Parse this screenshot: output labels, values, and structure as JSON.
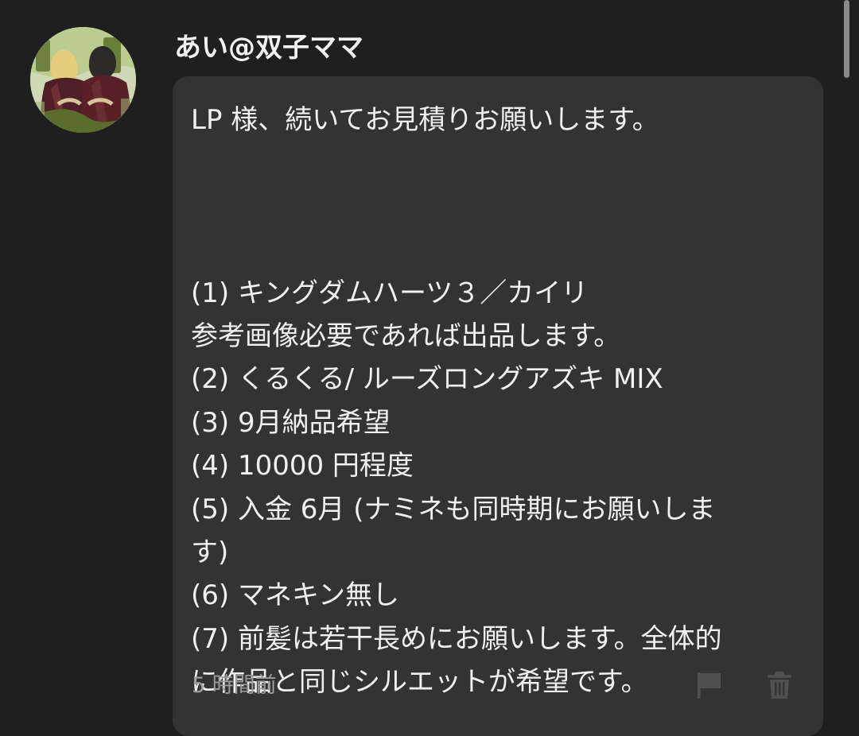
{
  "post": {
    "author_name": "あい@双子ママ",
    "avatar": {
      "icon": "avatar-image",
      "colors": [
        "#cfd9b6",
        "#61733b",
        "#4b1d24",
        "#d7c49b"
      ]
    },
    "message_lines": [
      "LP 様、続いてお見積りお願いします。",
      "",
      "",
      "(1) キングダムハーツ３／カイリ",
      "参考画像必要であれば出品します。",
      "(2) くるくる/  ルーズロングアズキ MIX",
      "(3) 9月納品希望",
      "(4) 10000 円程度",
      "(5) 入金 6月 (ナミネも同時期にお願いしま",
      "す)",
      "(6) マネキン無し",
      "(7) 前髪は若干長めにお願いします。全体的",
      "に作品と同じシルエットが希望です。"
    ],
    "timestamp": "5 時間前",
    "actions": {
      "flag": {
        "icon": "flag-icon"
      },
      "delete": {
        "icon": "trash-icon"
      }
    }
  },
  "theme": {
    "background": "#1f1f1f",
    "bubble": "#333333",
    "text": "#f1f1f1",
    "muted": "#9b9b9b"
  }
}
